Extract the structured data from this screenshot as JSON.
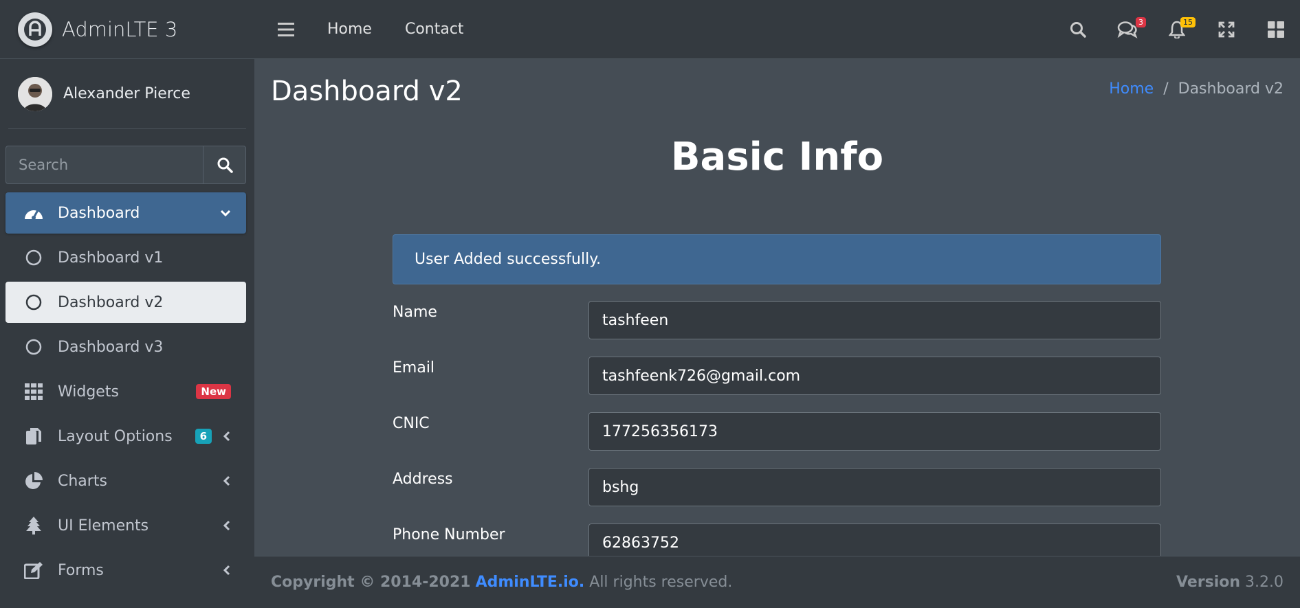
{
  "brand": {
    "name": "AdminLTE 3"
  },
  "user": {
    "name": "Alexander Pierce"
  },
  "sidebar_search": {
    "placeholder": "Search"
  },
  "sidebar": {
    "items": [
      {
        "label": "Dashboard",
        "icon": "tachometer-icon"
      },
      {
        "label": "Dashboard v1",
        "icon": "circle-icon"
      },
      {
        "label": "Dashboard v2",
        "icon": "circle-icon"
      },
      {
        "label": "Dashboard v3",
        "icon": "circle-icon"
      },
      {
        "label": "Widgets",
        "icon": "grid-icon",
        "badge": "New"
      },
      {
        "label": "Layout Options",
        "icon": "copy-icon",
        "badge": "6"
      },
      {
        "label": "Charts",
        "icon": "pie-chart-icon"
      },
      {
        "label": "UI Elements",
        "icon": "tree-icon"
      },
      {
        "label": "Forms",
        "icon": "edit-icon"
      }
    ]
  },
  "topnav": {
    "links": [
      "Home",
      "Contact"
    ],
    "messages_count": "3",
    "notifications_count": "15"
  },
  "page": {
    "title": "Dashboard v2",
    "breadcrumb": {
      "home": "Home",
      "separator": "/",
      "current": "Dashboard v2"
    }
  },
  "form": {
    "title": "Basic Info",
    "alert": "User Added successfully.",
    "fields": [
      {
        "label": "Name",
        "value": "tashfeen"
      },
      {
        "label": "Email",
        "value": "tashfeenk726@gmail.com"
      },
      {
        "label": "CNIC",
        "value": "177256356173"
      },
      {
        "label": "Address",
        "value": "bshg"
      },
      {
        "label": "Phone Number",
        "value": "62863752"
      }
    ]
  },
  "footer": {
    "copyright": "Copyright © 2014-2021",
    "link": "AdminLTE.io.",
    "rights": "All rights reserved.",
    "version_label": "Version",
    "version": "3.2.0"
  },
  "colors": {
    "sidebar_bg": "#343a40",
    "content_bg": "#454d55",
    "accent": "#3f6791",
    "link": "#3f8cff",
    "badge_red": "#dc3545",
    "badge_teal": "#17a2b8",
    "badge_yellow": "#ffc107"
  }
}
